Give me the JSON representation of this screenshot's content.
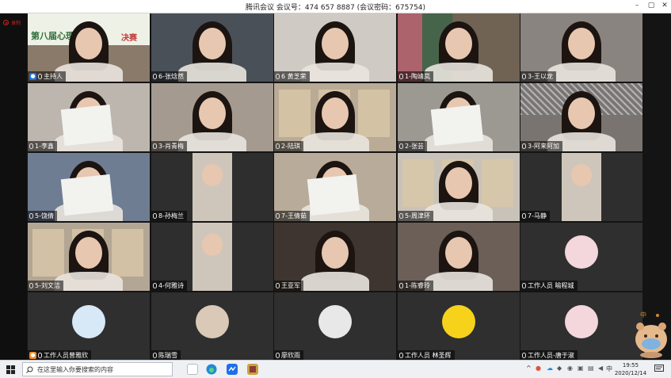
{
  "window": {
    "title": "腾讯会议 会议号：474 657 8887  (会议密码：675754)",
    "min": "–",
    "max": "▢",
    "close": "✕"
  },
  "recording": "录制",
  "participants": [
    {
      "name": "主持人",
      "badge": "host",
      "bg": "#8a7a6a"
    },
    {
      "name": "6-张焓然",
      "badge": "",
      "bg": "#4a5058"
    },
    {
      "name": "6 黄芝荣",
      "badge": "",
      "bg": "#cfcac4"
    },
    {
      "name": "1-陶靖岚",
      "badge": "",
      "bg": "#5a5248"
    },
    {
      "name": "3-王以龙",
      "badge": "",
      "bg": "#8a8480"
    },
    {
      "name": "1-李鑫",
      "badge": "",
      "bg": "#bdb6ae"
    },
    {
      "name": "3-肖青梅",
      "badge": "",
      "bg": "#a59a90"
    },
    {
      "name": "2-陆琪",
      "badge": "",
      "bg": "#b9ab96"
    },
    {
      "name": "2-张芸",
      "badge": "",
      "bg": "#9c9892"
    },
    {
      "name": "3-阿来阿加",
      "badge": "",
      "bg": "#7a7470"
    },
    {
      "name": "5-饶倩",
      "badge": "",
      "bg": "#6f7d93"
    },
    {
      "name": "8-孙梅兰",
      "badge": "",
      "bg": "#2e2e2e"
    },
    {
      "name": "7-王倩茹",
      "badge": "",
      "bg": "#b8ab9a"
    },
    {
      "name": "5-周津环",
      "badge": "",
      "bg": "#c9c2b8"
    },
    {
      "name": "7-马静",
      "badge": "",
      "bg": "#2e2e2e"
    },
    {
      "name": "5-刘文洁",
      "badge": "",
      "bg": "#b3a694"
    },
    {
      "name": "4-何雅诗",
      "badge": "",
      "bg": "#2e2e2e"
    },
    {
      "name": "王亚军",
      "badge": "",
      "bg": "#3e3530"
    },
    {
      "name": "1-陈睿玲",
      "badge": "",
      "bg": "#6b5f58"
    },
    {
      "name": "工作人员 喻程城",
      "badge": "",
      "bg": "#2f2f2f"
    },
    {
      "name": "工作人员曾雅欣",
      "badge": "orange",
      "bg": "#2f2f2f"
    },
    {
      "name": "陈瑞雪",
      "badge": "",
      "bg": "#2f2f2f"
    },
    {
      "name": "廖欣雨",
      "badge": "",
      "bg": "#2f2f2f"
    },
    {
      "name": "工作人员 林圣辉",
      "badge": "",
      "bg": "#2f2f2f"
    },
    {
      "name": "工作人员-唐于淑",
      "badge": "",
      "bg": "#2f2f2f"
    }
  ],
  "banner_text": "第八届心理",
  "banner_text2": "决赛",
  "taskbar": {
    "search_placeholder": "在这里输入你要搜索的内容",
    "time": "19:55",
    "date": "2020/12/14",
    "ime": "中"
  }
}
